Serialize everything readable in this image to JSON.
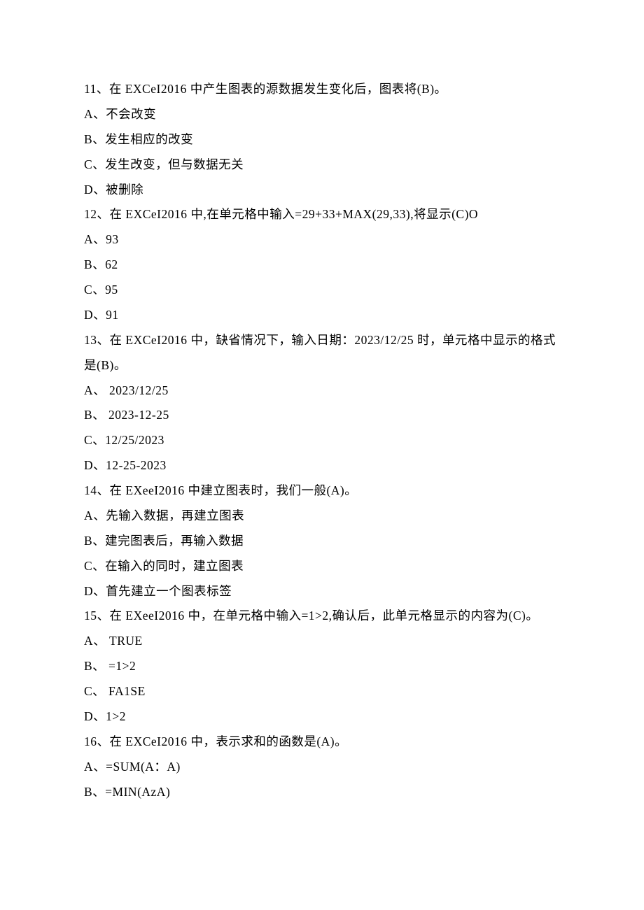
{
  "lines": [
    "11、在 EXCeI2016 中产生图表的源数据发生变化后，图表将(B)。",
    "A、不会改变",
    "B、发生相应的改变",
    "C、发生改变，但与数据无关",
    "D、被删除",
    "12、在 EXCeI2016 中,在单元格中输入=29+33+MAX(29,33),将显示(C)O",
    "A、93",
    "B、62",
    "C、95",
    "D、91",
    "13、在 EXCeI2016 中，缺省情况下，输入日期：2023/12/25 时，单元格中显示的格式是(B)。",
    "A、 2023/12/25",
    "B、 2023-12-25",
    "C、12/25/2023",
    "D、12-25-2023",
    "14、在 EXeeI2016 中建立图表时，我们一般(A)。",
    "A、先输入数据，再建立图表",
    "B、建完图表后，再输入数据",
    "C、在输入的同时，建立图表",
    "D、首先建立一个图表标签",
    "15、在 EXeeI2016 中，在单元格中输入=1>2,确认后，此单元格显示的内容为(C)。",
    "A、 TRUE",
    "B、 =1>2",
    "C、 FA1SE",
    "D、1>2",
    "16、在 EXCeI2016 中，表示求和的函数是(A)。",
    "A、=SUM(A：A)",
    "B、=MIN(AzA)"
  ]
}
